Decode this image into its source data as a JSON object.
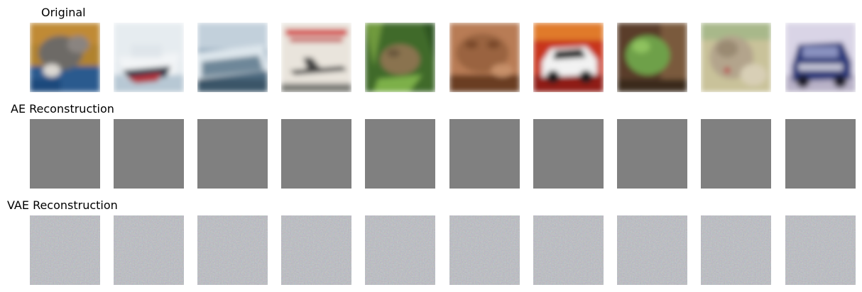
{
  "rows": [
    {
      "id": "original",
      "title": "Original"
    },
    {
      "id": "ae",
      "title": "AE Reconstruction"
    },
    {
      "id": "vae",
      "title": "VAE Reconstruction"
    }
  ],
  "images": {
    "original": [
      {
        "subject": "cat"
      },
      {
        "subject": "ship"
      },
      {
        "subject": "ship"
      },
      {
        "subject": "airplane"
      },
      {
        "subject": "frog"
      },
      {
        "subject": "frog"
      },
      {
        "subject": "automobile"
      },
      {
        "subject": "frog"
      },
      {
        "subject": "cat"
      },
      {
        "subject": "automobile"
      }
    ],
    "ae_reconstruction": {
      "appearance": "flat-gray",
      "color": "#808080",
      "count": 10
    },
    "vae_reconstruction": {
      "appearance": "gray-noise",
      "color": "#7b7d84",
      "count": 10
    }
  }
}
